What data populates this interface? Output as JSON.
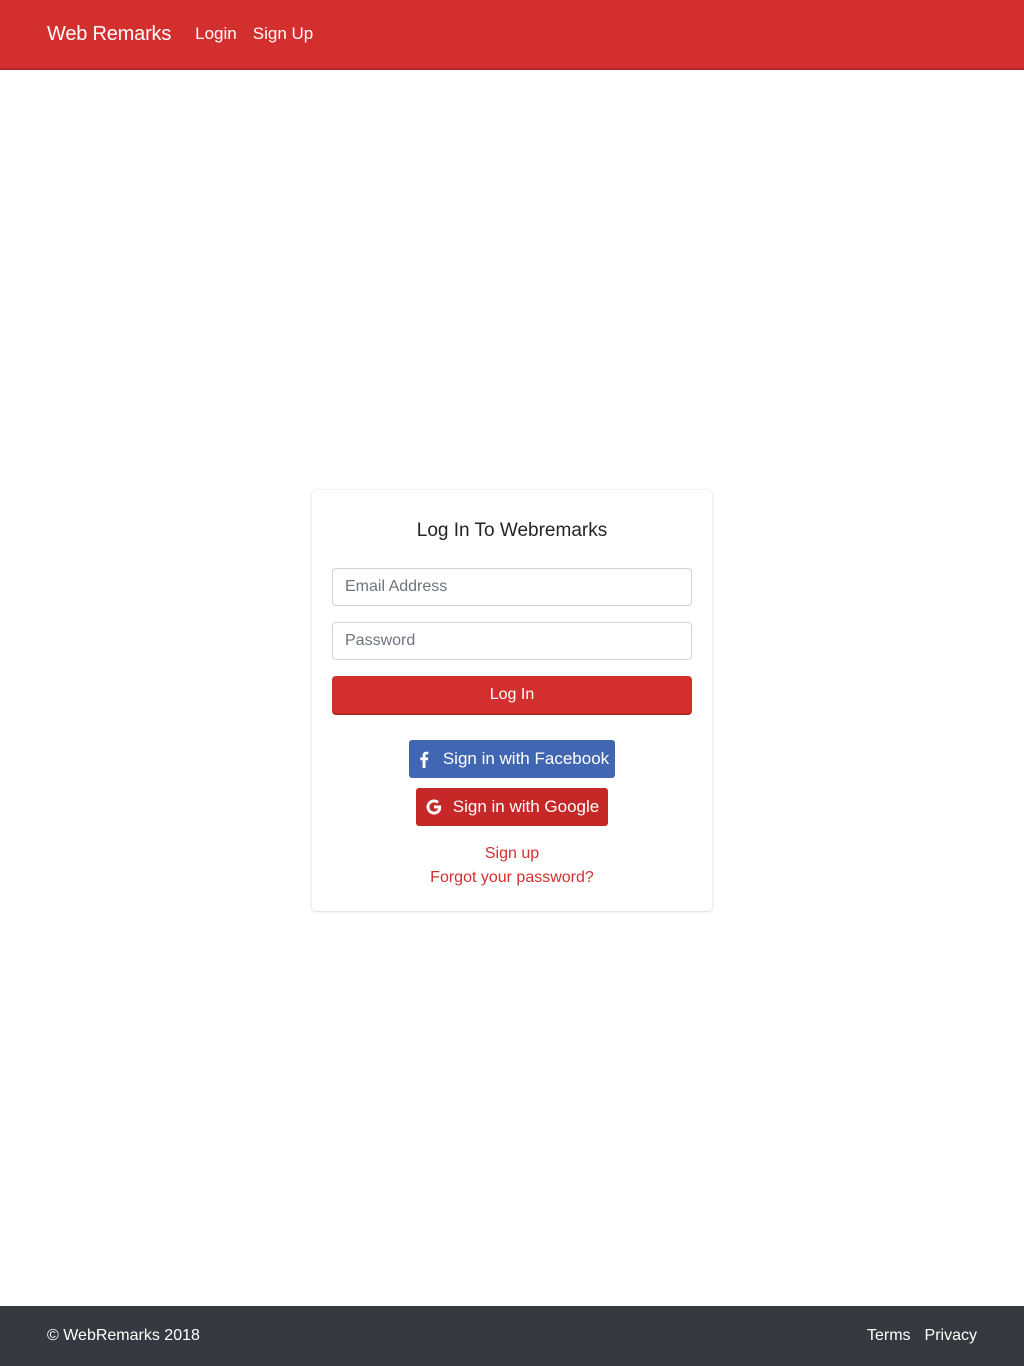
{
  "colors": {
    "brand_red": "#d32f2f",
    "facebook_blue": "#4267b2",
    "google_red": "#c62828",
    "footer_dark": "#343a40",
    "link_red": "#d32f2f"
  },
  "navbar": {
    "brand": "Web Remarks",
    "links": [
      "Login",
      "Sign Up"
    ]
  },
  "login_card": {
    "title": "Log In To Webremarks",
    "email_placeholder": "Email Address",
    "password_placeholder": "Password",
    "login_button": "Log In",
    "facebook_button": "Sign in with Facebook",
    "facebook_icon": "facebook-icon",
    "google_button": "Sign in with Google",
    "google_icon": "google-icon",
    "signup_link": "Sign up",
    "forgot_link": "Forgot your password?"
  },
  "footer": {
    "copyright": "© WebRemarks 2018",
    "links": [
      "Terms",
      "Privacy"
    ]
  }
}
